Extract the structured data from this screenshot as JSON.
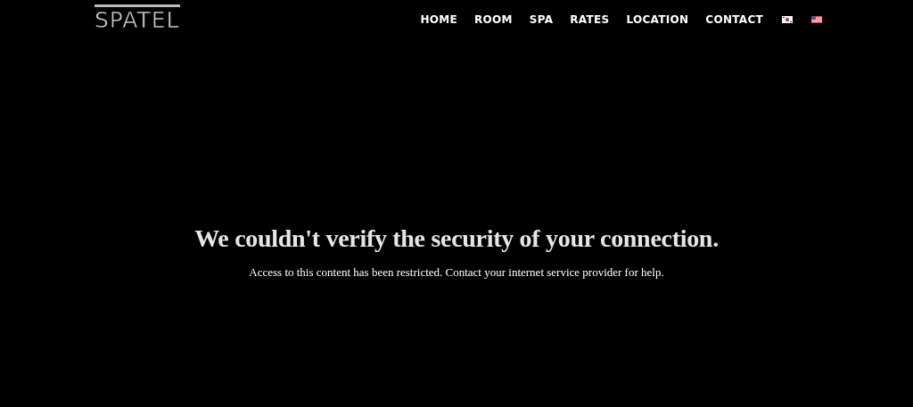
{
  "logo": {
    "text": "SPATEL"
  },
  "nav": {
    "items": [
      {
        "label": "HOME"
      },
      {
        "label": "ROOM"
      },
      {
        "label": "SPA"
      },
      {
        "label": "RATES"
      },
      {
        "label": "LOCATION"
      },
      {
        "label": "CONTACT"
      }
    ],
    "flags": [
      {
        "kind": "korea"
      },
      {
        "kind": "usa"
      }
    ]
  },
  "message": {
    "heading": "We couldn't verify the security of your connection.",
    "body": "Access to this content has been restricted. Contact your internet service provider for help."
  }
}
